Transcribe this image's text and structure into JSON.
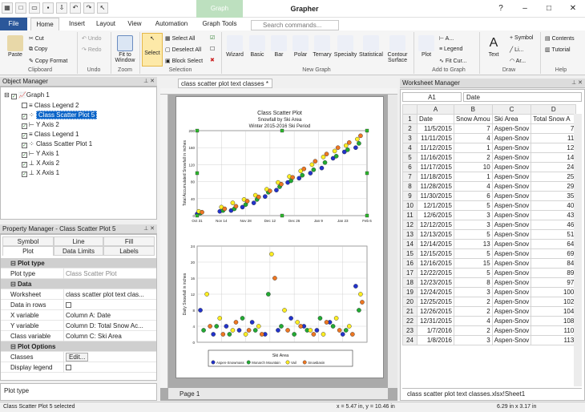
{
  "window": {
    "app_title": "Grapher",
    "context_tab": "Graph",
    "search_placeholder": "Search commands..."
  },
  "tabs": [
    "File",
    "Home",
    "Insert",
    "Layout",
    "View",
    "Automation",
    "Graph Tools"
  ],
  "ribbon": {
    "clipboard": {
      "paste": "Paste",
      "cut": "Cut",
      "copy": "Copy",
      "copy_format": "Copy Format",
      "title": "Clipboard"
    },
    "undo": {
      "undo": "Undo",
      "redo": "Redo",
      "title": "Undo"
    },
    "zoom": {
      "fit": "Fit to Window",
      "title": "Zoom"
    },
    "selection": {
      "select": "Select",
      "select_all": "Select All",
      "deselect_all": "Deselect All",
      "block_select": "Block Select",
      "title": "Selection"
    },
    "new_graph": {
      "wizard": "Wizard",
      "basic": "Basic",
      "bar": "Bar",
      "polar": "Polar",
      "ternary": "Ternary",
      "specialty": "Specialty",
      "statistical": "Statistical",
      "contour": "Contour Surface",
      "title": "New Graph"
    },
    "add_to_graph": {
      "plot": "Plot",
      "axis": "A...",
      "legend": "Legend",
      "fit_curve": "Fit Cur...",
      "title": "Add to Graph"
    },
    "draw": {
      "text": "Text",
      "symbol": "Symbol",
      "line": "Li...",
      "arc": "Ar...",
      "title": "Draw"
    },
    "help": {
      "contents": "Contents",
      "tutorial": "Tutorial",
      "title": "Help"
    }
  },
  "object_manager": {
    "title": "Object Manager",
    "items": [
      "Graph 1",
      "Class Legend 2",
      "Class Scatter Plot 5",
      "Y Axis 2",
      "Class Legend 1",
      "Class Scatter Plot 1",
      "Y Axis 1",
      "X Axis 2",
      "X Axis 1"
    ]
  },
  "property_manager": {
    "title": "Property Manager - Class Scatter Plot 5",
    "tabs": [
      "Symbol",
      "Line",
      "Fill",
      "Plot",
      "Data Limits",
      "Labels"
    ],
    "rows": [
      {
        "type": "section",
        "label": "Plot type"
      },
      {
        "k": "Plot type",
        "v": "Class Scatter Plot"
      },
      {
        "type": "section",
        "label": "Data"
      },
      {
        "k": "Worksheet",
        "v": "class scatter plot text clas..."
      },
      {
        "k": "Data in rows",
        "v": ""
      },
      {
        "k": "X variable",
        "v": "Column A: Date"
      },
      {
        "k": "Y variable",
        "v": "Column D: Total Snow Ac..."
      },
      {
        "k": "Class variable",
        "v": "Column C: Ski Area"
      },
      {
        "type": "section",
        "label": "Plot Options"
      },
      {
        "k": "Classes",
        "v": "Edit..."
      },
      {
        "k": "Display legend",
        "v": ""
      }
    ],
    "help_text": "Plot type"
  },
  "document": {
    "tab": "class scatter plot text classes *",
    "page_tab": "Page 1"
  },
  "chart_data": [
    {
      "type": "scatter",
      "title": "Class Scatter Plot",
      "subtitle": "Snowfall by Ski Area",
      "subtitle2": "Winter 2015-2016 Ski Period",
      "ylabel": "Total Accumulated Snowfall in inches",
      "x_ticks": [
        "Oct 31",
        "Nov 14",
        "Nov 28",
        "Dec 12",
        "Dec 26",
        "Jan 9",
        "Jan 23",
        "Feb 6"
      ],
      "y_ticks": [
        "0",
        "40",
        "80",
        "120",
        "160",
        "200"
      ],
      "ylim": [
        0,
        200
      ],
      "series": [
        {
          "name": "Aspen-Snowmass",
          "color": "#2233cc",
          "values": [
            [
              0,
              4
            ],
            [
              14,
              10
            ],
            [
              21,
              12
            ],
            [
              28,
              20
            ],
            [
              35,
              30
            ],
            [
              42,
              45
            ],
            [
              49,
              60
            ],
            [
              56,
              78
            ],
            [
              63,
              88
            ],
            [
              70,
              100
            ],
            [
              77,
              112
            ],
            [
              84,
              135
            ],
            [
              91,
              150
            ],
            [
              98,
              160
            ]
          ]
        },
        {
          "name": "Monarch Mountain",
          "color": "#22aa33",
          "values": [
            [
              2,
              6
            ],
            [
              16,
              12
            ],
            [
              23,
              16
            ],
            [
              30,
              26
            ],
            [
              37,
              38
            ],
            [
              44,
              55
            ],
            [
              51,
              68
            ],
            [
              58,
              82
            ],
            [
              65,
              95
            ],
            [
              72,
              108
            ],
            [
              79,
              125
            ],
            [
              86,
              140
            ],
            [
              93,
              155
            ],
            [
              100,
              170
            ]
          ]
        },
        {
          "name": "Vail",
          "color": "#ffee22",
          "values": [
            [
              1,
              10
            ],
            [
              15,
              20
            ],
            [
              22,
              30
            ],
            [
              29,
              38
            ],
            [
              36,
              48
            ],
            [
              43,
              62
            ],
            [
              50,
              78
            ],
            [
              57,
              92
            ],
            [
              64,
              105
            ],
            [
              71,
              120
            ],
            [
              78,
              138
            ],
            [
              85,
              152
            ],
            [
              92,
              165
            ],
            [
              99,
              180
            ]
          ]
        },
        {
          "name": "Snowbasin",
          "color": "#ee7722",
          "values": [
            [
              3,
              8
            ],
            [
              17,
              16
            ],
            [
              24,
              22
            ],
            [
              31,
              34
            ],
            [
              38,
              44
            ],
            [
              45,
              58
            ],
            [
              52,
              74
            ],
            [
              59,
              90
            ],
            [
              66,
              110
            ],
            [
              73,
              128
            ],
            [
              80,
              145
            ],
            [
              87,
              160
            ],
            [
              94,
              172
            ],
            [
              101,
              188
            ]
          ]
        }
      ]
    },
    {
      "type": "scatter",
      "ylabel": "Daily Snowfall in inches",
      "y_ticks": [
        "0",
        "4",
        "8",
        "12",
        "16",
        "20",
        "24"
      ],
      "ylim": [
        0,
        24
      ],
      "legend_title": "Ski Area",
      "series": [
        {
          "name": "Aspen-Snowmass",
          "color": "#2233cc",
          "values": [
            [
              2,
              8
            ],
            [
              10,
              2
            ],
            [
              18,
              4
            ],
            [
              26,
              3
            ],
            [
              34,
              5
            ],
            [
              42,
              2
            ],
            [
              50,
              3
            ],
            [
              58,
              6
            ],
            [
              66,
              4
            ],
            [
              74,
              3
            ],
            [
              82,
              5
            ],
            [
              90,
              2
            ],
            [
              98,
              14
            ]
          ]
        },
        {
          "name": "Monarch Mountain",
          "color": "#22aa33",
          "values": [
            [
              4,
              3
            ],
            [
              12,
              4
            ],
            [
              20,
              2
            ],
            [
              28,
              6
            ],
            [
              36,
              3
            ],
            [
              44,
              12
            ],
            [
              52,
              4
            ],
            [
              60,
              2
            ],
            [
              68,
              3
            ],
            [
              76,
              6
            ],
            [
              84,
              4
            ],
            [
              92,
              3
            ],
            [
              100,
              8
            ]
          ]
        },
        {
          "name": "Vail",
          "color": "#ffee22",
          "values": [
            [
              6,
              12
            ],
            [
              14,
              6
            ],
            [
              22,
              3
            ],
            [
              30,
              2
            ],
            [
              38,
              4
            ],
            [
              46,
              22
            ],
            [
              54,
              8
            ],
            [
              62,
              5
            ],
            [
              70,
              3
            ],
            [
              78,
              2
            ],
            [
              86,
              6
            ],
            [
              94,
              4
            ],
            [
              101,
              12
            ]
          ]
        },
        {
          "name": "Snowbasin",
          "color": "#ee7722",
          "values": [
            [
              8,
              4
            ],
            [
              16,
              2
            ],
            [
              24,
              5
            ],
            [
              32,
              3
            ],
            [
              40,
              2
            ],
            [
              48,
              16
            ],
            [
              56,
              3
            ],
            [
              64,
              4
            ],
            [
              72,
              2
            ],
            [
              80,
              5
            ],
            [
              88,
              3
            ],
            [
              96,
              2
            ],
            [
              102,
              10
            ]
          ]
        }
      ]
    }
  ],
  "worksheet": {
    "title": "Worksheet Manager",
    "cell_ref": "A1",
    "cell_value": "Date",
    "columns": [
      "A",
      "B",
      "C",
      "D"
    ],
    "rows": [
      [
        "Date",
        "Snow Amou",
        "Ski Area",
        "Total Snow A"
      ],
      [
        "11/5/2015",
        "7",
        "Aspen-Snov",
        "7"
      ],
      [
        "11/11/2015",
        "4",
        "Aspen-Snov",
        "11"
      ],
      [
        "11/12/2015",
        "1",
        "Aspen-Snov",
        "12"
      ],
      [
        "11/16/2015",
        "2",
        "Aspen-Snov",
        "14"
      ],
      [
        "11/17/2015",
        "10",
        "Aspen-Snov",
        "24"
      ],
      [
        "11/18/2015",
        "1",
        "Aspen-Snov",
        "25"
      ],
      [
        "11/28/2015",
        "4",
        "Aspen-Snov",
        "29"
      ],
      [
        "11/30/2015",
        "6",
        "Aspen-Snov",
        "35"
      ],
      [
        "12/1/2015",
        "5",
        "Aspen-Snov",
        "40"
      ],
      [
        "12/6/2015",
        "3",
        "Aspen-Snov",
        "43"
      ],
      [
        "12/12/2015",
        "3",
        "Aspen-Snov",
        "46"
      ],
      [
        "12/13/2015",
        "5",
        "Aspen-Snov",
        "51"
      ],
      [
        "12/14/2015",
        "13",
        "Aspen-Snov",
        "64"
      ],
      [
        "12/15/2015",
        "5",
        "Aspen-Snov",
        "69"
      ],
      [
        "12/16/2015",
        "15",
        "Aspen-Snov",
        "84"
      ],
      [
        "12/22/2015",
        "5",
        "Aspen-Snov",
        "89"
      ],
      [
        "12/23/2015",
        "8",
        "Aspen-Snov",
        "97"
      ],
      [
        "12/24/2015",
        "3",
        "Aspen-Snov",
        "100"
      ],
      [
        "12/25/2015",
        "2",
        "Aspen-Snov",
        "102"
      ],
      [
        "12/26/2015",
        "2",
        "Aspen-Snov",
        "104"
      ],
      [
        "12/31/2015",
        "4",
        "Aspen-Snov",
        "108"
      ],
      [
        "1/7/2016",
        "2",
        "Aspen-Snov",
        "110"
      ],
      [
        "1/8/2016",
        "3",
        "Aspen-Snov",
        "113"
      ]
    ],
    "sheet_tab": "class scatter plot text classes.xlsx!Sheet1"
  },
  "status": {
    "left": "Class Scatter Plot 5 selected",
    "mid": "x = 5.47 in, y = 10.46 in",
    "right": "6.29 in x 3.17 in"
  }
}
